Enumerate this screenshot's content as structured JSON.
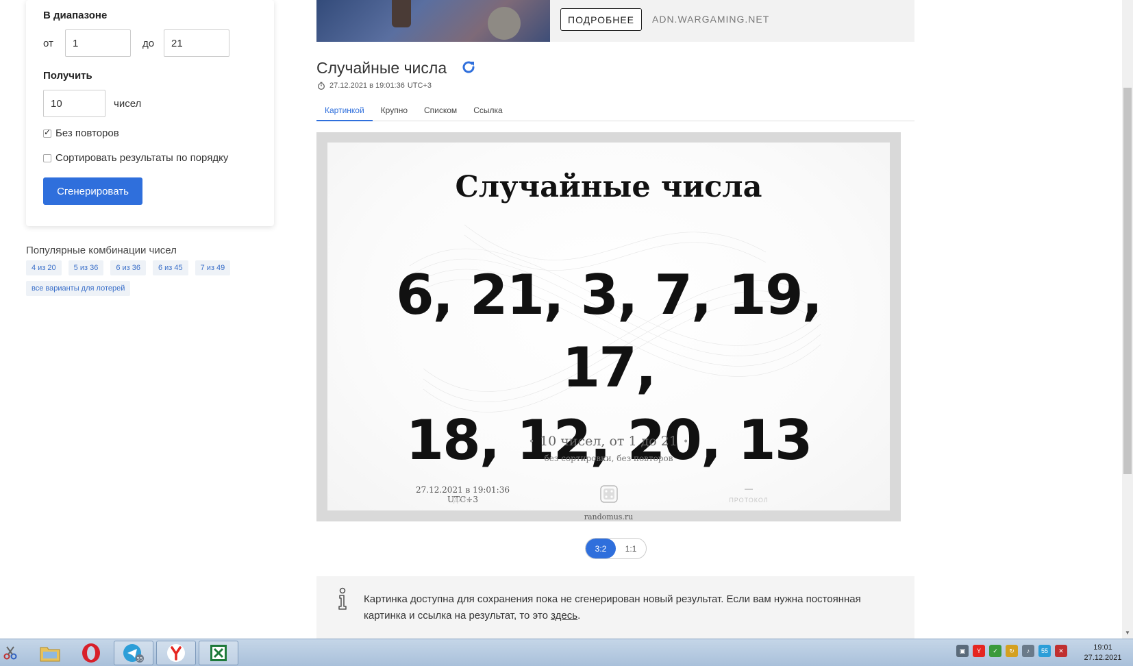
{
  "sidebar": {
    "range_heading": "В диапазоне",
    "from_label": "от",
    "from_value": "1",
    "to_label": "до",
    "to_value": "21",
    "get_heading": "Получить",
    "count_value": "10",
    "count_unit": "чисел",
    "no_repeat_label": "Без повторов",
    "no_repeat_checked": true,
    "sort_label": "Сортировать результаты по порядку",
    "sort_checked": false,
    "generate_button": "Сгенерировать"
  },
  "popular": {
    "title": "Популярные комбинации чисел",
    "tags": [
      "4 из 20",
      "5 из 36",
      "6 из 36",
      "6 из 45",
      "7 из 49",
      "все варианты для лотерей"
    ]
  },
  "ad": {
    "more_button": "ПОДРОБНЕЕ",
    "domain": "ADN.WARGAMING.NET"
  },
  "header": {
    "title": "Случайные числа",
    "timestamp": "27.12.2021 в 19:01:36",
    "timezone": "UTC+3"
  },
  "tabs": [
    {
      "label": "Картинкой",
      "active": true
    },
    {
      "label": "Крупно",
      "active": false
    },
    {
      "label": "Списком",
      "active": false
    },
    {
      "label": "Ссылка",
      "active": false
    }
  ],
  "result": {
    "title": "Случайные числа",
    "numbers_line1": "6, 21, 3, 7, 19, 17,",
    "numbers_line2": "18, 12, 20, 13",
    "summary": "10 чисел, от 1 до 21",
    "sub": "без сортировки, без повторов",
    "date": "27.12.2021 в 19:01:36 UTC+3",
    "date_caption": "ДАТА",
    "protocol_value": "—",
    "protocol_caption": "ПРОТОКОЛ",
    "site": "randomus.ru"
  },
  "ratio": {
    "options": [
      "3:2",
      "1:1"
    ],
    "selected": "3:2"
  },
  "info": {
    "text": "Картинка доступна для сохранения пока не сгенерирован новый результат. Если вам нужна постоянная картинка и ссылка на результат, то это ",
    "link": "здесь",
    "end": "."
  },
  "taskbar": {
    "time": "19:01",
    "date": "27.12.2021",
    "telegram_badge": "55",
    "tray_badge": "55"
  },
  "colors": {
    "accent": "#2f6fdc",
    "tag_bg": "#eef2f7",
    "frame": "#d9d9d9"
  }
}
